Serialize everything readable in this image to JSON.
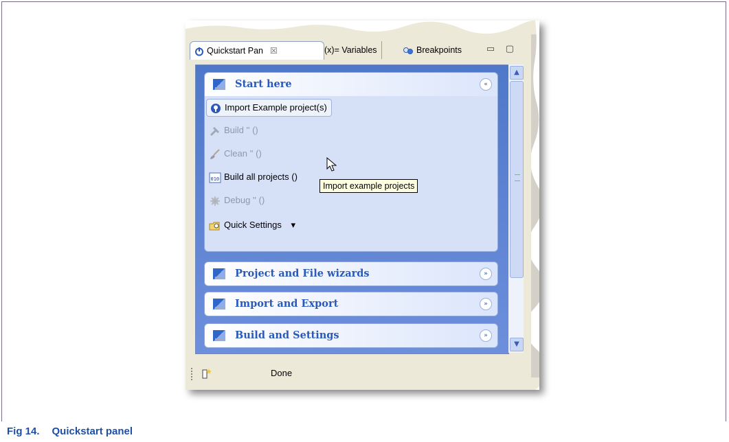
{
  "tabs": [
    {
      "label": "Quickstart Pan",
      "close": "☒",
      "active": true
    },
    {
      "label": "(x)= Variables",
      "active": false
    },
    {
      "label": "Breakpoints",
      "active": false
    }
  ],
  "window_controls": "▭ ▢",
  "sections": [
    {
      "title": "Start here",
      "expanded": true,
      "toggle": "«"
    },
    {
      "title": "Project and File wizards",
      "expanded": false,
      "toggle": "»"
    },
    {
      "title": "Import and Export",
      "expanded": false,
      "toggle": "»"
    },
    {
      "title": "Build and Settings",
      "expanded": false,
      "toggle": "»"
    }
  ],
  "start_here_items": [
    {
      "label": "Import Example project(s)",
      "icon": "lightbulb-icon",
      "enabled": true
    },
    {
      "label": "Build '' ()",
      "icon": "hammer-icon",
      "enabled": false
    },
    {
      "label": "Clean '' ()",
      "icon": "broom-icon",
      "enabled": false
    },
    {
      "label": "Build all projects ()",
      "icon": "binary-icon",
      "enabled": true
    },
    {
      "label": "Debug '' ()",
      "icon": "debug-icon",
      "enabled": false
    },
    {
      "label": "Quick Settings",
      "icon": "folder-settings-icon",
      "enabled": true,
      "dropdown": "▾"
    }
  ],
  "tooltip": "Import example projects",
  "status": {
    "text": "Done"
  },
  "caption": {
    "number": "Fig 14.",
    "title": "Quickstart panel"
  },
  "colors": {
    "accent": "#2a59b9",
    "panel": "#d6e0f7",
    "caption": "#1f4fa3"
  }
}
